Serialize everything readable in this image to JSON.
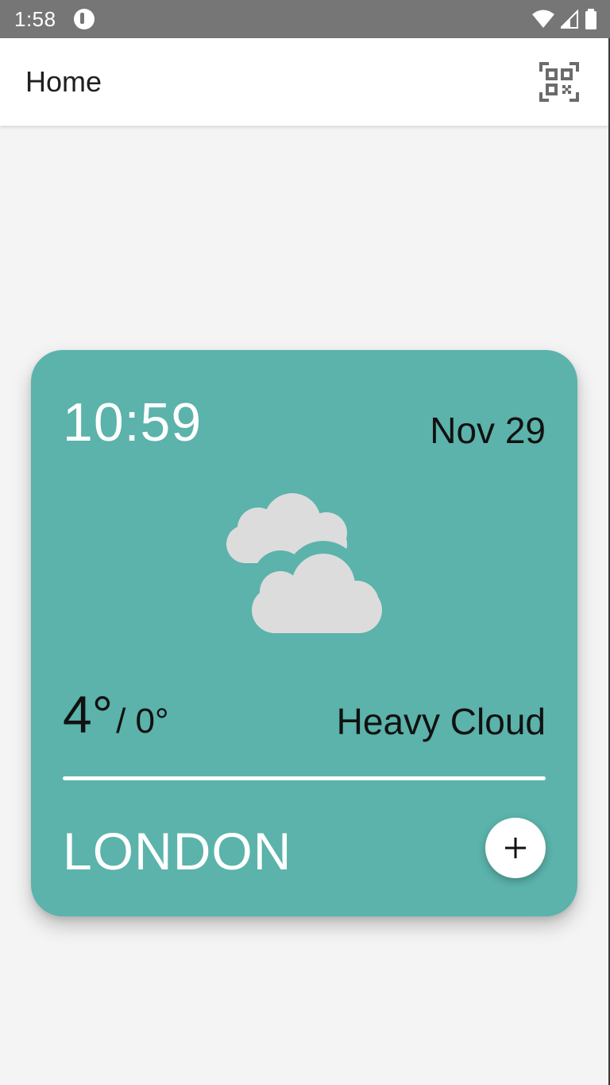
{
  "status_bar": {
    "time": "1:58",
    "icons": [
      "app-notification-icon",
      "wifi-icon",
      "cellular-signal-icon",
      "battery-icon"
    ]
  },
  "app_bar": {
    "title": "Home",
    "action_icon": "qr-code-scan-icon"
  },
  "weather_card": {
    "time": "10:59",
    "date": "Nov 29",
    "icon": "heavy-cloud-icon",
    "temp_high": "4°",
    "temp_low": "/ 0°",
    "condition": "Heavy Cloud",
    "city": "LONDON",
    "add_button_icon": "plus-icon",
    "background_color": "#5bb3ab"
  },
  "colors": {
    "status_bar": "#767676",
    "app_bar": "#ffffff",
    "page_background": "#f4f4f4",
    "card": "#5bb3ab",
    "cloud": "#dcdcdc"
  }
}
